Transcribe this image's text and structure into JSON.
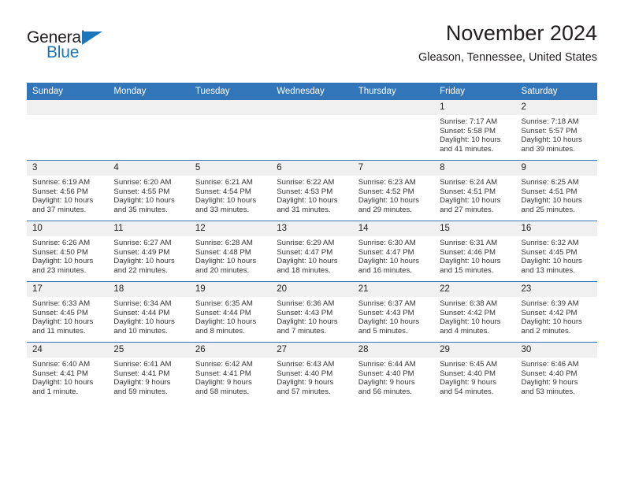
{
  "brand": {
    "name_part1": "General",
    "name_part2": "Blue",
    "accent_color": "#1b75bb"
  },
  "header": {
    "title": "November 2024",
    "location": "Gleason, Tennessee, United States"
  },
  "theme": {
    "header_bar_color": "#3275b8",
    "daynum_band_color": "#f0f0f0",
    "row_divider_color": "#3275b8",
    "text_color": "#231f20"
  },
  "weekday_headers": [
    "Sunday",
    "Monday",
    "Tuesday",
    "Wednesday",
    "Thursday",
    "Friday",
    "Saturday"
  ],
  "labels": {
    "sunrise_prefix": "Sunrise:",
    "sunset_prefix": "Sunset:",
    "daylight_prefix": "Daylight:"
  },
  "weeks": [
    [
      {
        "day": "",
        "empty": true
      },
      {
        "day": "",
        "empty": true
      },
      {
        "day": "",
        "empty": true
      },
      {
        "day": "",
        "empty": true
      },
      {
        "day": "",
        "empty": true
      },
      {
        "day": "1",
        "sunrise": "Sunrise: 7:17 AM",
        "sunset": "Sunset: 5:58 PM",
        "daylight_l1": "Daylight: 10 hours",
        "daylight_l2": "and 41 minutes."
      },
      {
        "day": "2",
        "sunrise": "Sunrise: 7:18 AM",
        "sunset": "Sunset: 5:57 PM",
        "daylight_l1": "Daylight: 10 hours",
        "daylight_l2": "and 39 minutes."
      }
    ],
    [
      {
        "day": "3",
        "sunrise": "Sunrise: 6:19 AM",
        "sunset": "Sunset: 4:56 PM",
        "daylight_l1": "Daylight: 10 hours",
        "daylight_l2": "and 37 minutes."
      },
      {
        "day": "4",
        "sunrise": "Sunrise: 6:20 AM",
        "sunset": "Sunset: 4:55 PM",
        "daylight_l1": "Daylight: 10 hours",
        "daylight_l2": "and 35 minutes."
      },
      {
        "day": "5",
        "sunrise": "Sunrise: 6:21 AM",
        "sunset": "Sunset: 4:54 PM",
        "daylight_l1": "Daylight: 10 hours",
        "daylight_l2": "and 33 minutes."
      },
      {
        "day": "6",
        "sunrise": "Sunrise: 6:22 AM",
        "sunset": "Sunset: 4:53 PM",
        "daylight_l1": "Daylight: 10 hours",
        "daylight_l2": "and 31 minutes."
      },
      {
        "day": "7",
        "sunrise": "Sunrise: 6:23 AM",
        "sunset": "Sunset: 4:52 PM",
        "daylight_l1": "Daylight: 10 hours",
        "daylight_l2": "and 29 minutes."
      },
      {
        "day": "8",
        "sunrise": "Sunrise: 6:24 AM",
        "sunset": "Sunset: 4:51 PM",
        "daylight_l1": "Daylight: 10 hours",
        "daylight_l2": "and 27 minutes."
      },
      {
        "day": "9",
        "sunrise": "Sunrise: 6:25 AM",
        "sunset": "Sunset: 4:51 PM",
        "daylight_l1": "Daylight: 10 hours",
        "daylight_l2": "and 25 minutes."
      }
    ],
    [
      {
        "day": "10",
        "sunrise": "Sunrise: 6:26 AM",
        "sunset": "Sunset: 4:50 PM",
        "daylight_l1": "Daylight: 10 hours",
        "daylight_l2": "and 23 minutes."
      },
      {
        "day": "11",
        "sunrise": "Sunrise: 6:27 AM",
        "sunset": "Sunset: 4:49 PM",
        "daylight_l1": "Daylight: 10 hours",
        "daylight_l2": "and 22 minutes."
      },
      {
        "day": "12",
        "sunrise": "Sunrise: 6:28 AM",
        "sunset": "Sunset: 4:48 PM",
        "daylight_l1": "Daylight: 10 hours",
        "daylight_l2": "and 20 minutes."
      },
      {
        "day": "13",
        "sunrise": "Sunrise: 6:29 AM",
        "sunset": "Sunset: 4:47 PM",
        "daylight_l1": "Daylight: 10 hours",
        "daylight_l2": "and 18 minutes."
      },
      {
        "day": "14",
        "sunrise": "Sunrise: 6:30 AM",
        "sunset": "Sunset: 4:47 PM",
        "daylight_l1": "Daylight: 10 hours",
        "daylight_l2": "and 16 minutes."
      },
      {
        "day": "15",
        "sunrise": "Sunrise: 6:31 AM",
        "sunset": "Sunset: 4:46 PM",
        "daylight_l1": "Daylight: 10 hours",
        "daylight_l2": "and 15 minutes."
      },
      {
        "day": "16",
        "sunrise": "Sunrise: 6:32 AM",
        "sunset": "Sunset: 4:45 PM",
        "daylight_l1": "Daylight: 10 hours",
        "daylight_l2": "and 13 minutes."
      }
    ],
    [
      {
        "day": "17",
        "sunrise": "Sunrise: 6:33 AM",
        "sunset": "Sunset: 4:45 PM",
        "daylight_l1": "Daylight: 10 hours",
        "daylight_l2": "and 11 minutes."
      },
      {
        "day": "18",
        "sunrise": "Sunrise: 6:34 AM",
        "sunset": "Sunset: 4:44 PM",
        "daylight_l1": "Daylight: 10 hours",
        "daylight_l2": "and 10 minutes."
      },
      {
        "day": "19",
        "sunrise": "Sunrise: 6:35 AM",
        "sunset": "Sunset: 4:44 PM",
        "daylight_l1": "Daylight: 10 hours",
        "daylight_l2": "and 8 minutes."
      },
      {
        "day": "20",
        "sunrise": "Sunrise: 6:36 AM",
        "sunset": "Sunset: 4:43 PM",
        "daylight_l1": "Daylight: 10 hours",
        "daylight_l2": "and 7 minutes."
      },
      {
        "day": "21",
        "sunrise": "Sunrise: 6:37 AM",
        "sunset": "Sunset: 4:43 PM",
        "daylight_l1": "Daylight: 10 hours",
        "daylight_l2": "and 5 minutes."
      },
      {
        "day": "22",
        "sunrise": "Sunrise: 6:38 AM",
        "sunset": "Sunset: 4:42 PM",
        "daylight_l1": "Daylight: 10 hours",
        "daylight_l2": "and 4 minutes."
      },
      {
        "day": "23",
        "sunrise": "Sunrise: 6:39 AM",
        "sunset": "Sunset: 4:42 PM",
        "daylight_l1": "Daylight: 10 hours",
        "daylight_l2": "and 2 minutes."
      }
    ],
    [
      {
        "day": "24",
        "sunrise": "Sunrise: 6:40 AM",
        "sunset": "Sunset: 4:41 PM",
        "daylight_l1": "Daylight: 10 hours",
        "daylight_l2": "and 1 minute."
      },
      {
        "day": "25",
        "sunrise": "Sunrise: 6:41 AM",
        "sunset": "Sunset: 4:41 PM",
        "daylight_l1": "Daylight: 9 hours",
        "daylight_l2": "and 59 minutes."
      },
      {
        "day": "26",
        "sunrise": "Sunrise: 6:42 AM",
        "sunset": "Sunset: 4:41 PM",
        "daylight_l1": "Daylight: 9 hours",
        "daylight_l2": "and 58 minutes."
      },
      {
        "day": "27",
        "sunrise": "Sunrise: 6:43 AM",
        "sunset": "Sunset: 4:40 PM",
        "daylight_l1": "Daylight: 9 hours",
        "daylight_l2": "and 57 minutes."
      },
      {
        "day": "28",
        "sunrise": "Sunrise: 6:44 AM",
        "sunset": "Sunset: 4:40 PM",
        "daylight_l1": "Daylight: 9 hours",
        "daylight_l2": "and 56 minutes."
      },
      {
        "day": "29",
        "sunrise": "Sunrise: 6:45 AM",
        "sunset": "Sunset: 4:40 PM",
        "daylight_l1": "Daylight: 9 hours",
        "daylight_l2": "and 54 minutes."
      },
      {
        "day": "30",
        "sunrise": "Sunrise: 6:46 AM",
        "sunset": "Sunset: 4:40 PM",
        "daylight_l1": "Daylight: 9 hours",
        "daylight_l2": "and 53 minutes."
      }
    ]
  ]
}
